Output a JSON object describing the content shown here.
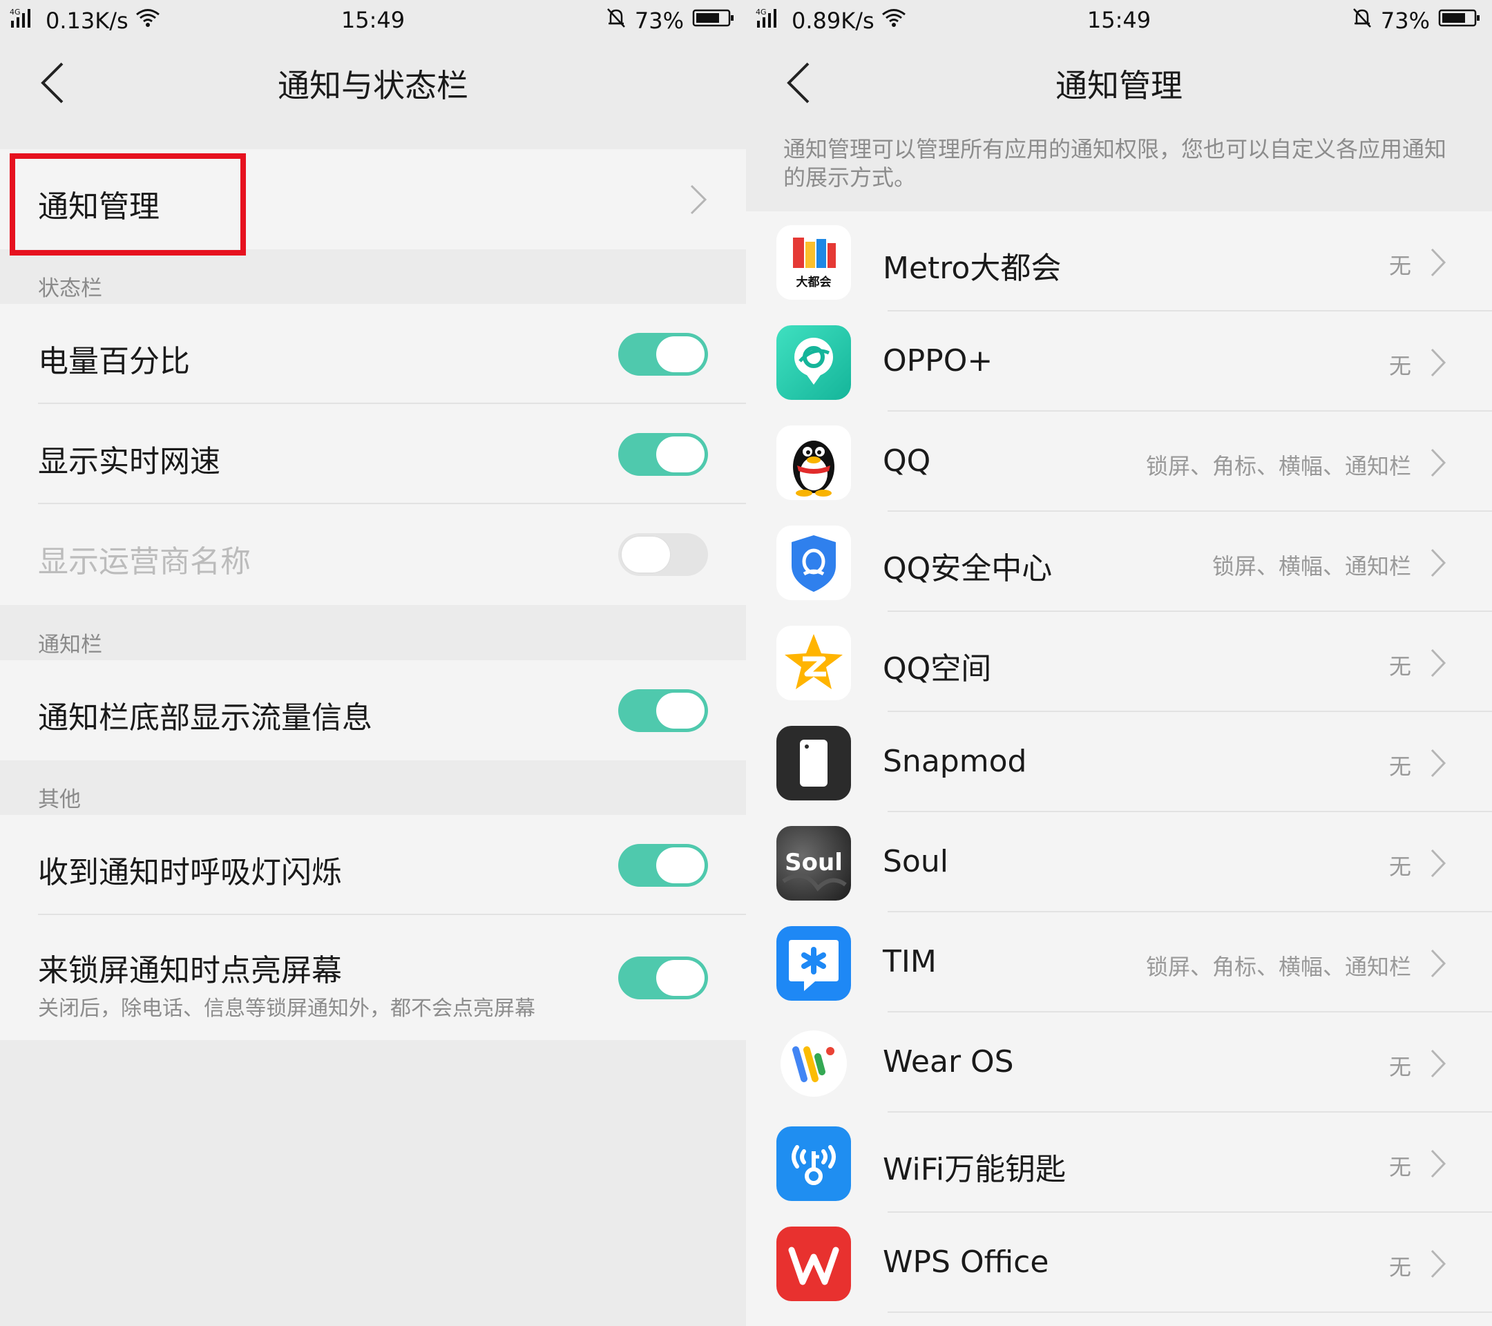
{
  "left_screen": {
    "status_bar": {
      "network": "4G",
      "speed": "0.13K/s",
      "time": "15:49",
      "battery": "73%"
    },
    "title": "通知与状态栏",
    "highlight_color": "#e6111f",
    "notification_management": {
      "label": "通知管理"
    },
    "sections": {
      "status_bar": "状态栏",
      "notification_bar": "通知栏",
      "other": "其他"
    },
    "settings": [
      {
        "label": "电量百分比",
        "on": true,
        "enabled": true
      },
      {
        "label": "显示实时网速",
        "on": true,
        "enabled": true
      },
      {
        "label": "显示运营商名称",
        "on": false,
        "enabled": false
      },
      {
        "label": "通知栏底部显示流量信息",
        "on": true,
        "enabled": true
      },
      {
        "label": "收到通知时呼吸灯闪烁",
        "on": true,
        "enabled": true
      },
      {
        "label": "来锁屏通知时点亮屏幕",
        "sub": "关闭后，除电话、信息等锁屏通知外，都不会点亮屏幕",
        "on": true,
        "enabled": true
      }
    ],
    "toggle_on_color": "#4fc9ad"
  },
  "right_screen": {
    "status_bar": {
      "network": "4G",
      "speed": "0.89K/s",
      "time": "15:49",
      "battery": "73%"
    },
    "title": "通知管理",
    "description": "通知管理可以管理所有应用的通知权限，您也可以自定义各应用通知的展示方式。",
    "apps": [
      {
        "name": "Metro大都会",
        "status": "无",
        "icon": "metro-app-icon",
        "icon_text": "大都会"
      },
      {
        "name": "OPPO+",
        "status": "无",
        "icon": "oppo-plus-app-icon"
      },
      {
        "name": "QQ",
        "status": "锁屏、角标、横幅、通知栏",
        "icon": "qq-app-icon"
      },
      {
        "name": "QQ安全中心",
        "status": "锁屏、横幅、通知栏",
        "icon": "qq-security-app-icon"
      },
      {
        "name": "QQ空间",
        "status": "无",
        "icon": "qzone-app-icon"
      },
      {
        "name": "Snapmod",
        "status": "无",
        "icon": "snapmod-app-icon"
      },
      {
        "name": "Soul",
        "status": "无",
        "icon": "soul-app-icon",
        "icon_text": "Soul"
      },
      {
        "name": "TIM",
        "status": "锁屏、角标、横幅、通知栏",
        "icon": "tim-app-icon"
      },
      {
        "name": "Wear OS",
        "status": "无",
        "icon": "wear-os-app-icon"
      },
      {
        "name": "WiFi万能钥匙",
        "status": "无",
        "icon": "wifi-key-app-icon"
      },
      {
        "name": "WPS Office",
        "status": "无",
        "icon": "wps-office-app-icon"
      }
    ]
  }
}
